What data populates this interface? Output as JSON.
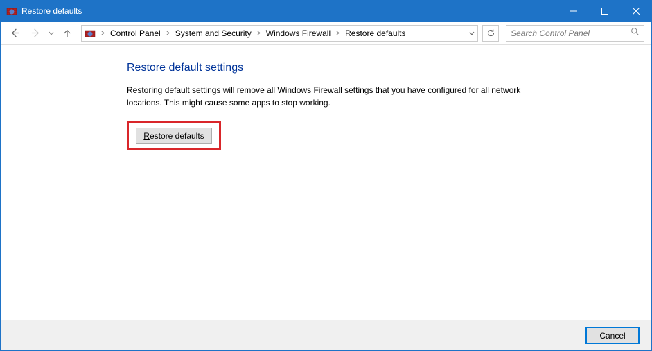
{
  "window": {
    "title": "Restore defaults"
  },
  "breadcrumb": {
    "items": [
      "Control Panel",
      "System and Security",
      "Windows Firewall",
      "Restore defaults"
    ]
  },
  "search": {
    "placeholder": "Search Control Panel"
  },
  "main": {
    "heading": "Restore default settings",
    "description": "Restoring default settings will remove all Windows Firewall settings that you have configured for all network locations. This might cause some apps to stop working.",
    "restore_button_prefix": "R",
    "restore_button_suffix": "estore defaults"
  },
  "footer": {
    "cancel": "Cancel"
  }
}
